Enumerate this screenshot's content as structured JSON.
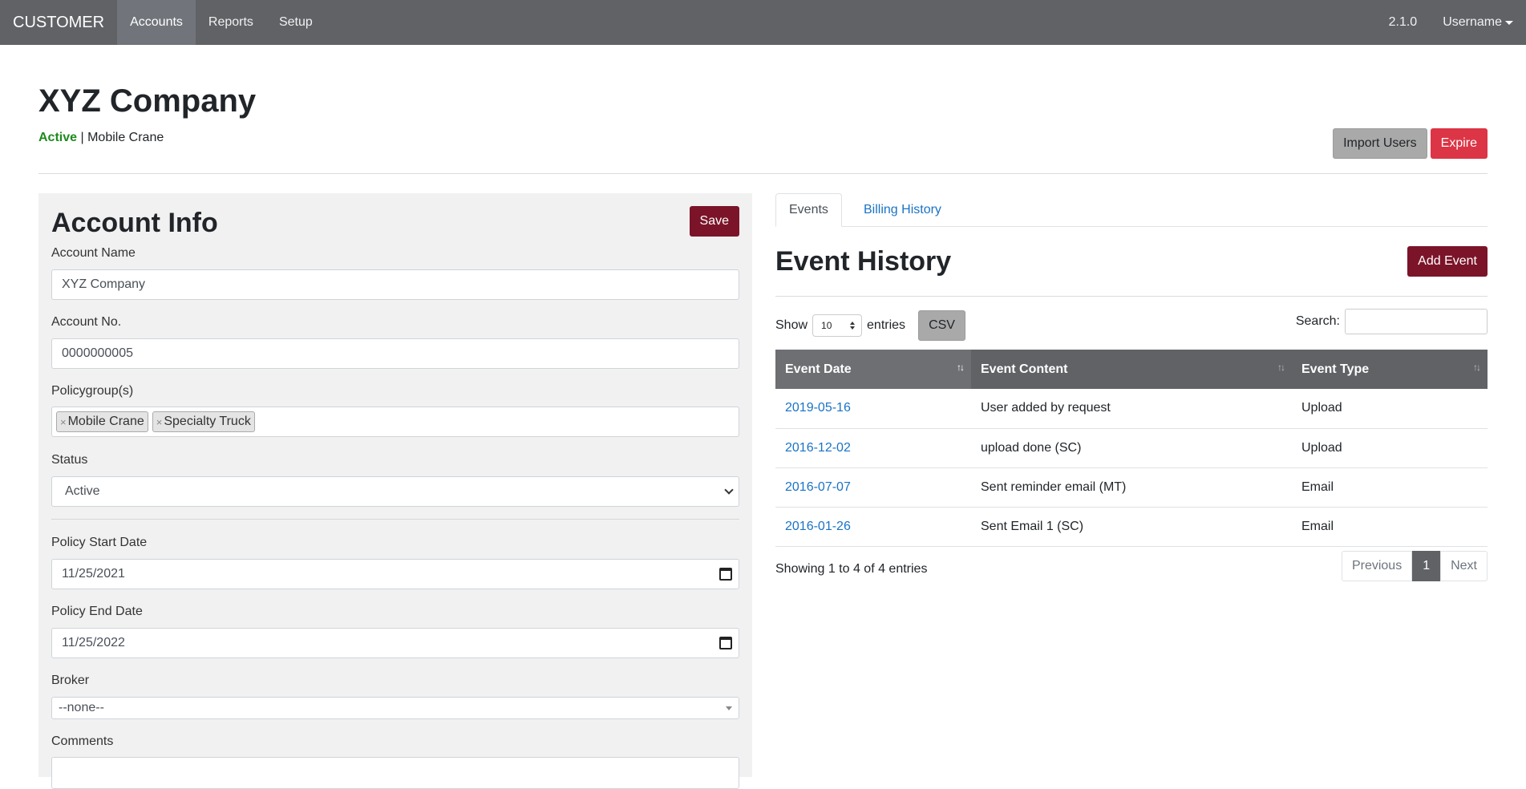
{
  "navbar": {
    "brand": "CUSTOMER",
    "links": [
      "Accounts",
      "Reports",
      "Setup"
    ],
    "version": "2.1.0",
    "user": "Username"
  },
  "header": {
    "title": "XYZ Company",
    "status": "Active",
    "separator": "|",
    "policygroup": "Mobile Crane",
    "import_users": "Import Users",
    "expire": "Expire"
  },
  "account": {
    "title": "Account Info",
    "save": "Save",
    "name_label": "Account Name",
    "name_value": "XYZ Company",
    "number_label": "Account No.",
    "number_value": "0000000005",
    "policygroups_label": "Policygroup(s)",
    "policygroups": [
      "Mobile Crane",
      "Specialty Truck"
    ],
    "status_label": "Status",
    "status_value": "Active",
    "start_label": "Policy Start Date",
    "start_value": "11/25/2021",
    "end_label": "Policy End Date",
    "end_value": "11/25/2022",
    "broker_label": "Broker",
    "broker_value": "--none--",
    "comments_label": "Comments"
  },
  "events": {
    "tabs": [
      "Events",
      "Billing History"
    ],
    "title": "Event History",
    "add_event": "Add Event",
    "show": "Show",
    "length_value": "10",
    "entries": "entries",
    "csv": "CSV",
    "search_label": "Search:",
    "columns": [
      "Event Date",
      "Event Content",
      "Event Type"
    ],
    "rows": [
      {
        "date": "2019-05-16",
        "content": "User added by request",
        "type": "Upload"
      },
      {
        "date": "2016-12-02",
        "content": "upload done (SC)",
        "type": "Upload"
      },
      {
        "date": "2016-07-07",
        "content": "Sent reminder email (MT)",
        "type": "Email"
      },
      {
        "date": "2016-01-26",
        "content": "Sent Email 1 (SC)",
        "type": "Email"
      }
    ],
    "info": "Showing 1 to 4 of 4 entries",
    "pager": {
      "previous": "Previous",
      "page": "1",
      "next": "Next"
    }
  },
  "colors": {
    "navbar": "#606266",
    "active": "#1e8a1e",
    "maroon": "#7b1429",
    "danger": "#dc3545",
    "link": "#1a73c6"
  }
}
